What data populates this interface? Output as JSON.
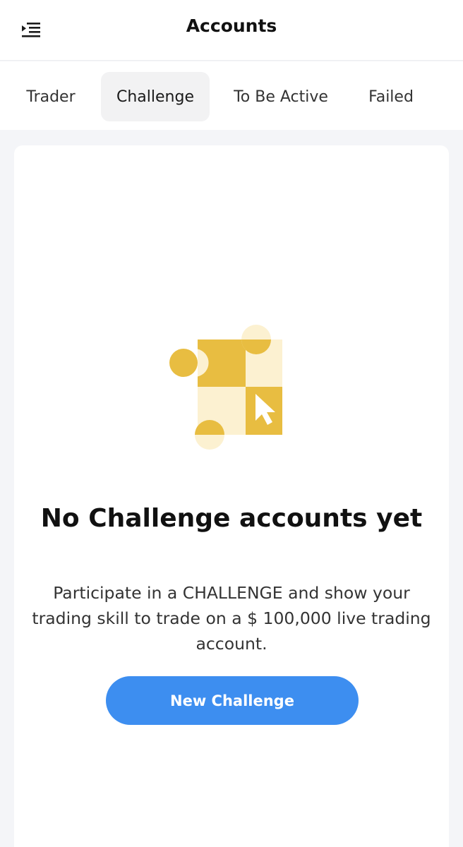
{
  "header": {
    "title": "Accounts",
    "menu_icon": "menu-collapse-icon"
  },
  "tabs": [
    {
      "label": "Trader",
      "active": false
    },
    {
      "label": "Challenge",
      "active": true
    },
    {
      "label": "To Be Active",
      "active": false
    },
    {
      "label": "Failed",
      "active": false
    }
  ],
  "empty_state": {
    "illustration_icon": "checkerboard-cursor-illustration",
    "title": "No Challenge accounts yet",
    "description": "Participate in a CHALLENGE and show your trading skill to trade on a $ 100,000 live trading account.",
    "button_label": "New Challenge"
  },
  "colors": {
    "accent": "#3d8ef0",
    "illustration_gold": "#e8bd41",
    "illustration_light": "#fcf1d1",
    "background": "#f4f5f8"
  }
}
